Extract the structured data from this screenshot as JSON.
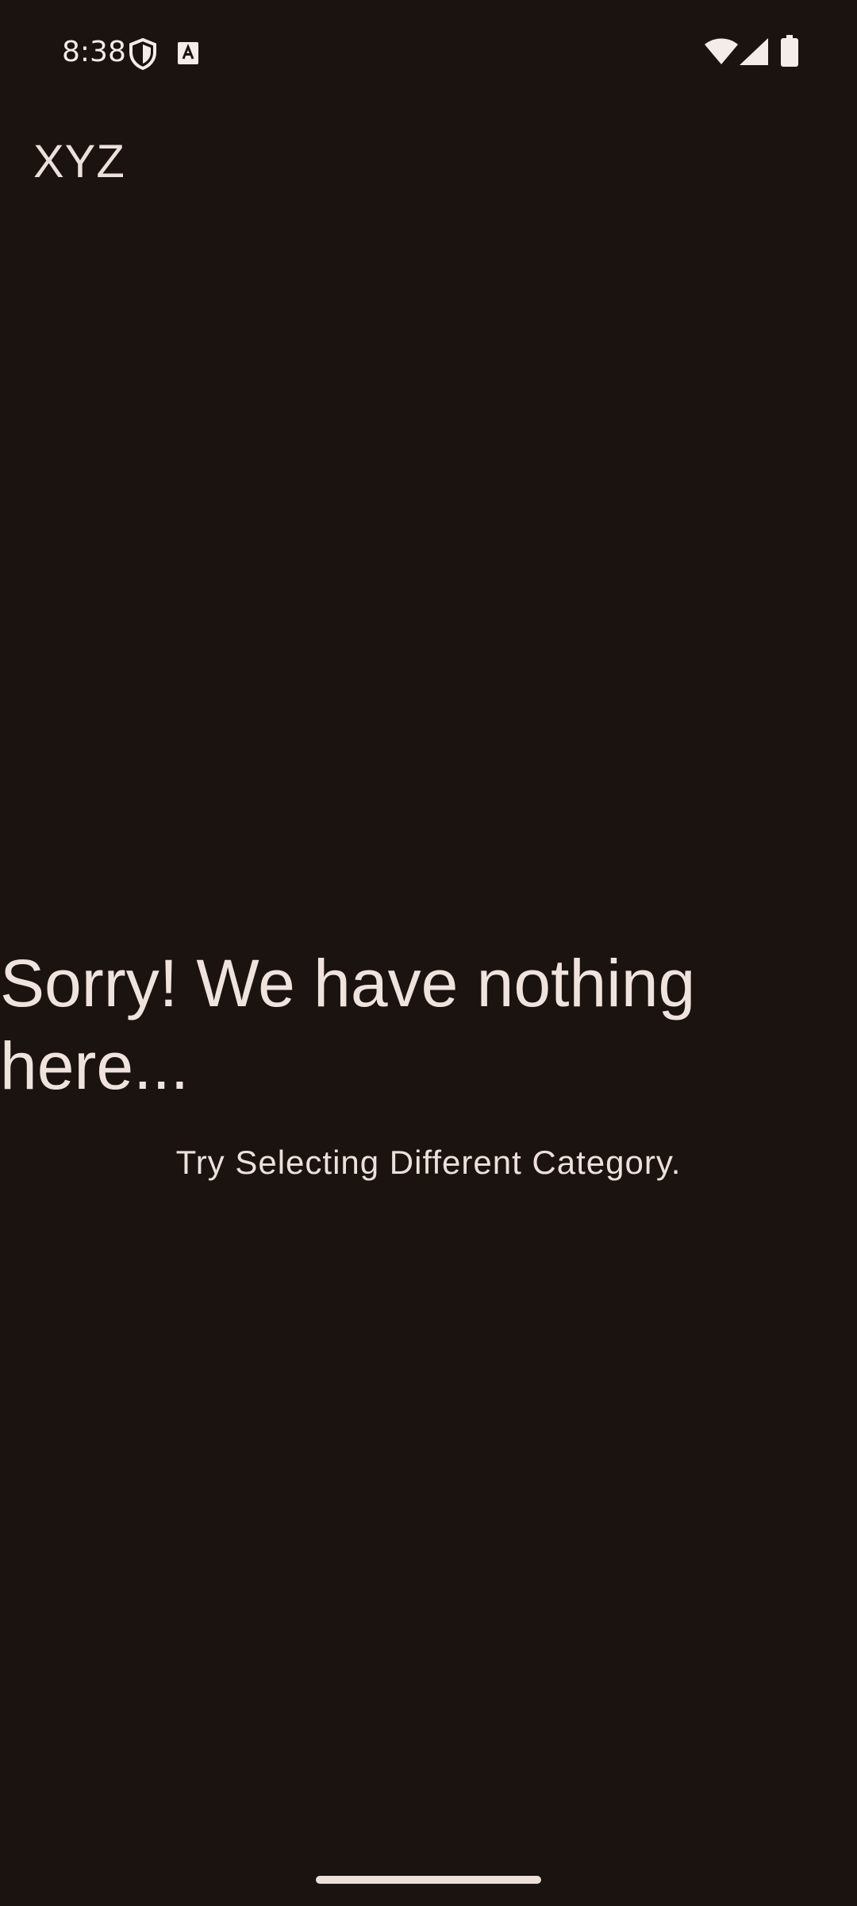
{
  "status_bar": {
    "time": "8:38",
    "icons": [
      "shield-icon",
      "font-icon",
      "wifi-icon",
      "signal-icon",
      "battery-icon"
    ]
  },
  "header": {
    "title": "XYZ"
  },
  "empty_state": {
    "title": "Sorry! We have nothing here...",
    "subtitle": "Try Selecting Different Category."
  },
  "colors": {
    "background": "#1a1310",
    "text": "#ede0db"
  }
}
